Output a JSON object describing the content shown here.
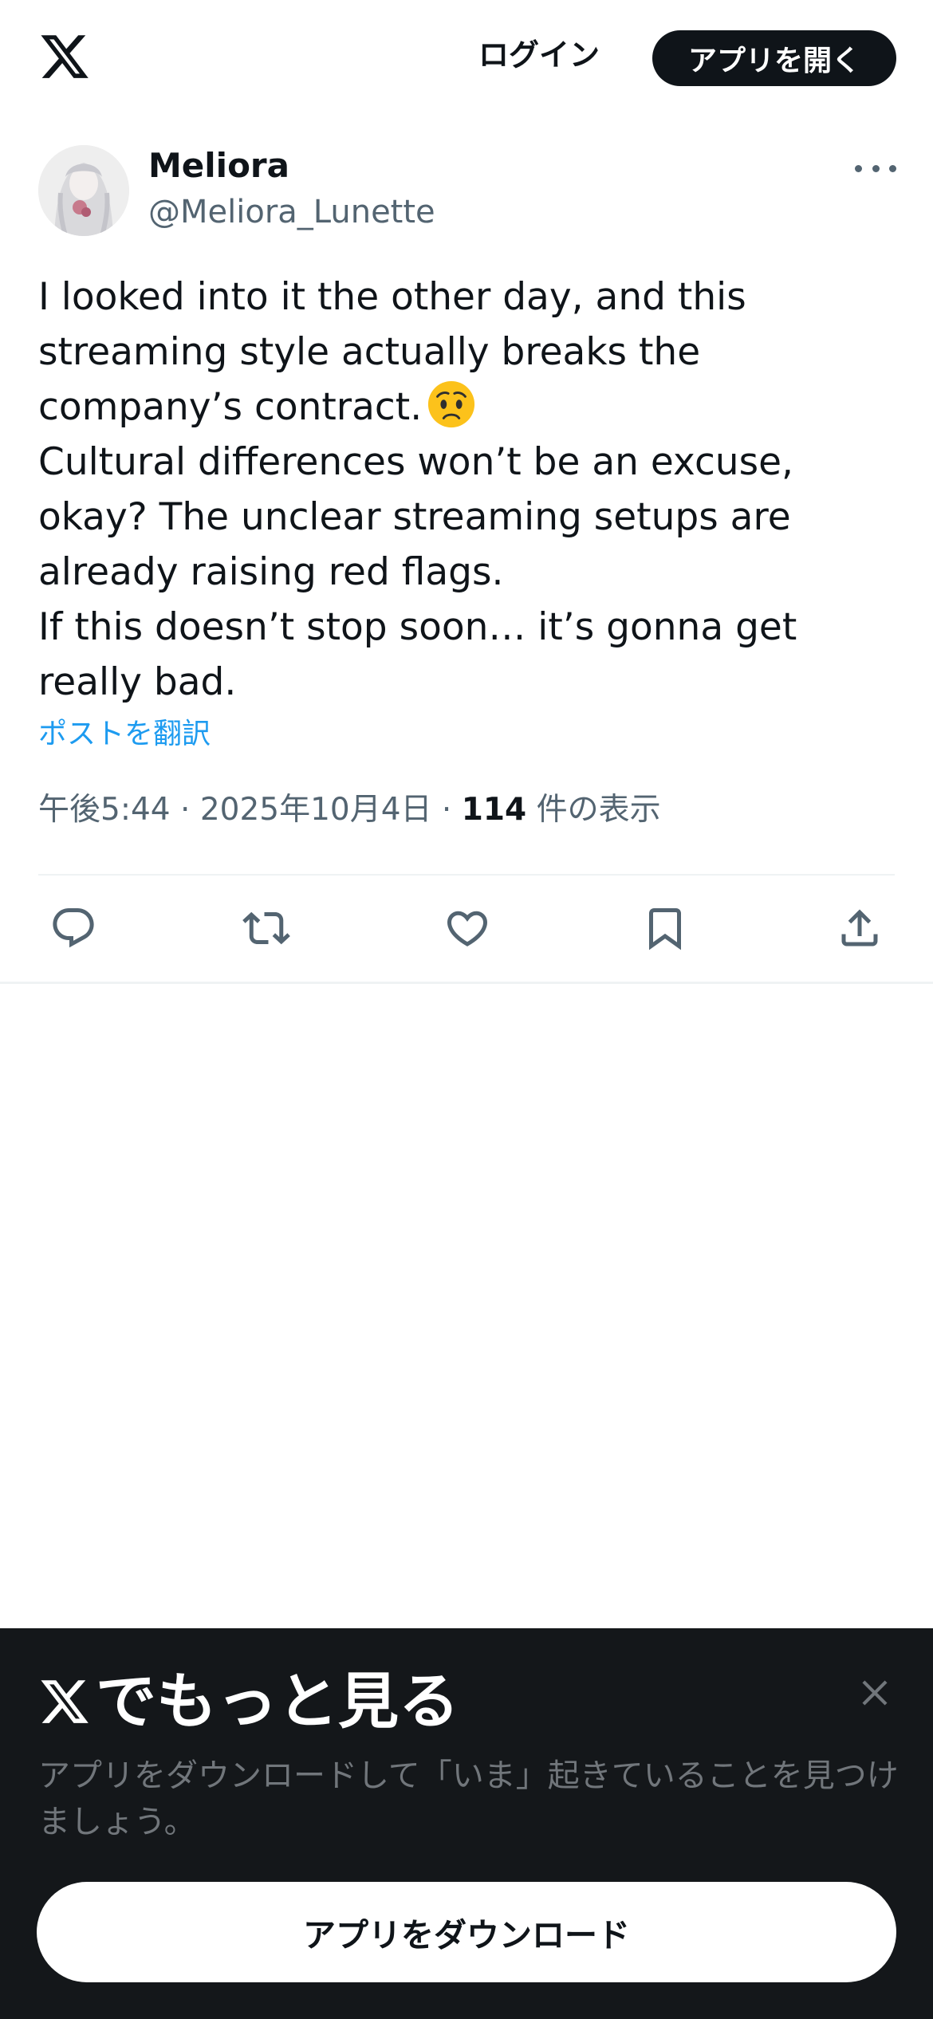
{
  "header": {
    "logo_icon": "x-logo-icon",
    "login_label": "ログイン",
    "open_app_label": "アプリを開く"
  },
  "post": {
    "author": {
      "display_name": "Meliora",
      "handle": "@Meliora_Lunette",
      "avatar_icon": "avatar-image"
    },
    "text_lines": [
      "I looked into it the other day, and this",
      "streaming style actually breaks the",
      "company’s contract.",
      "Cultural differences won’t be an excuse,",
      "okay? The unclear streaming setups are",
      "already raising red flags.",
      "If this doesn’t stop soon… it’s gonna get",
      "really bad."
    ],
    "emoji": "worried-face-emoji",
    "translate_label": "ポストを翻訳",
    "time": "午後5:44",
    "date": "2025年10月4日",
    "separator": "·",
    "views_count": "114",
    "views_label": "件の表示",
    "actions": [
      "reply-icon",
      "repost-icon",
      "like-icon",
      "bookmark-icon",
      "share-icon"
    ]
  },
  "sheet": {
    "title_suffix": "でもっと見る",
    "description": "アプリをダウンロードして「いま」起きていることを見つけましょう。",
    "download_label": "アプリをダウンロード",
    "close_icon": "close-icon"
  },
  "colors": {
    "text_primary": "#0f1419",
    "text_secondary": "#536471",
    "link": "#1d9bf0",
    "sheet_bg": "#14171a",
    "sheet_text_secondary": "#71767b",
    "divider": "#eff3f4"
  }
}
